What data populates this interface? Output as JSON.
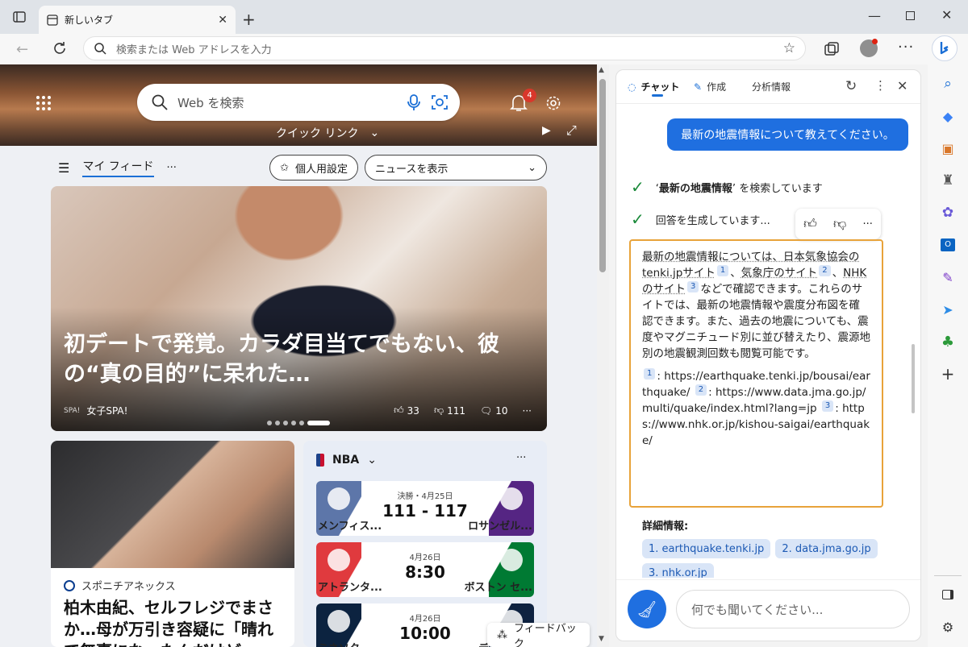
{
  "browser": {
    "tab_title": "新しいタブ",
    "address_placeholder": "検索または Web アドレスを入力"
  },
  "ntp": {
    "search_placeholder": "Web を検索",
    "notification_count": "4",
    "quick_links": "クイック リンク",
    "feed_label": "マイ フィード",
    "personalize_label": "個人用設定",
    "news_select": "ニュースを表示",
    "main_card": {
      "headline": "初デートで発覚。カラダ目当てでもない、彼の“真の目的”に呆れた…",
      "source": "女子SPA!",
      "likes": "33",
      "dislikes": "111",
      "comments": "10"
    },
    "card2": {
      "source": "スポニチアネックス",
      "title": "柏木由紀、セルフレジでまさか…母が万引き容疑に「晴れて無事になったんだけど」"
    },
    "sports": {
      "league": "NBA",
      "games": [
        {
          "status": "決勝・4月25日",
          "score": "111 - 117",
          "team1": "メンフィス...",
          "team2": "ロサンゼル...",
          "c1": "#5d76a9",
          "c2": "#552583"
        },
        {
          "status": "4月26日",
          "score": "8:30",
          "team1": "アトランタ...",
          "team2": "ボストン セ...",
          "c1": "#e03a3e",
          "c2": "#007a33"
        },
        {
          "status": "4月26日",
          "score": "10:00",
          "team1": "ミネソタ...",
          "team2": "デンバー...",
          "c1": "#0c2340",
          "c2": "#0e2240"
        }
      ]
    },
    "feedback_label": "フィードバック"
  },
  "chat": {
    "tabs": [
      "チャット",
      "作成",
      "分析情報"
    ],
    "user_message": "最新の地震情報について教えてください。",
    "step1_query": "最新の地震情報",
    "step1_suffix": "を検索しています",
    "step2": "回答を生成しています...",
    "answer": {
      "intro": "最新の地震情報については、日本気象協会の",
      "site1": "tenki.jpサイト",
      "sep1": "、",
      "site2": "気象庁のサイト",
      "sep2": "、",
      "site3": "NHKのサイト",
      "rest": "などで確認できます。これらのサイトでは、最新の地震情報や震度分布図を確認できます。また、過去の地震についても、震度やマグニチュード別に並び替えたり、震源地別の地震観測回数も閲覧可能です。",
      "refs": [
        {
          "n": "1",
          "url": "https://earthquake.tenki.jp/bousai/earthquake/"
        },
        {
          "n": "2",
          "url": "https://www.data.jma.go.jp/multi/quake/index.html?lang=jp"
        },
        {
          "n": "3",
          "url": "https://www.nhk.or.jp/kishou-saigai/earthquake/"
        }
      ]
    },
    "more_info_label": "詳細情報:",
    "chips": [
      "1. earthquake.tenki.jp",
      "2. data.jma.go.jp",
      "3. nhk.or.jp"
    ],
    "input_placeholder": "何でも聞いてください..."
  },
  "colors": {
    "accent": "#1f6fe0",
    "answer_border": "#e8a33a"
  }
}
